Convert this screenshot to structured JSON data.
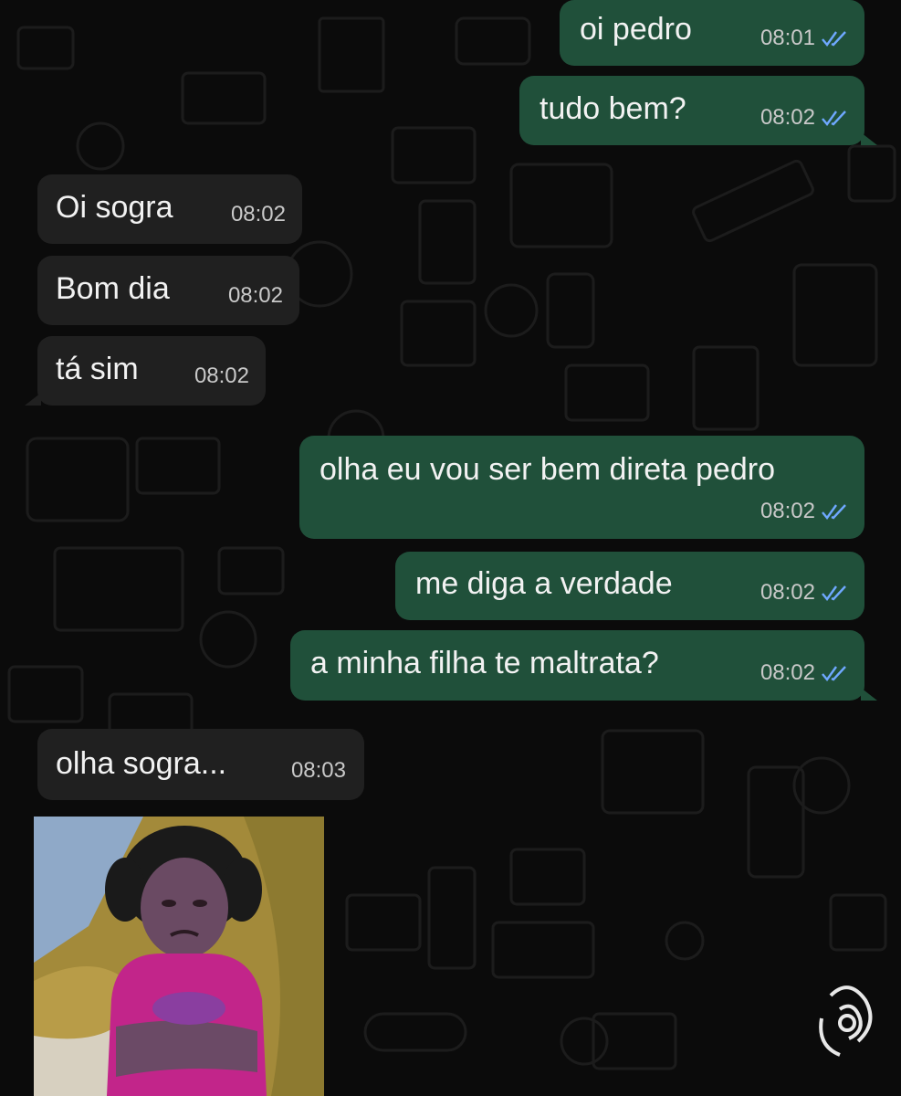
{
  "colors": {
    "background": "#0b0b0b",
    "outgoing_bubble": "#20503a",
    "incoming_bubble": "#202020",
    "read_ticks": "#6fa8ff"
  },
  "messages": [
    {
      "direction": "out",
      "text": "oi pedro",
      "time": "08:01",
      "status": "read"
    },
    {
      "direction": "out",
      "text": "tudo bem?",
      "time": "08:02",
      "status": "read"
    },
    {
      "direction": "in",
      "text": "Oi sogra",
      "time": "08:02"
    },
    {
      "direction": "in",
      "text": "Bom dia",
      "time": "08:02"
    },
    {
      "direction": "in",
      "text": "tá sim",
      "time": "08:02"
    },
    {
      "direction": "out",
      "text": "olha eu vou ser bem direta pedro",
      "time": "08:02",
      "status": "read"
    },
    {
      "direction": "out",
      "text": "me diga a verdade",
      "time": "08:02",
      "status": "read"
    },
    {
      "direction": "out",
      "text": "a minha filha te maltrata?",
      "time": "08:02",
      "status": "read"
    },
    {
      "direction": "in",
      "text": "olha sogra...",
      "time": "08:03"
    }
  ],
  "media": {
    "type": "photo",
    "subject": "crying-girl-photo"
  },
  "icons": [
    "double-check-icon",
    "watermark-logo"
  ]
}
